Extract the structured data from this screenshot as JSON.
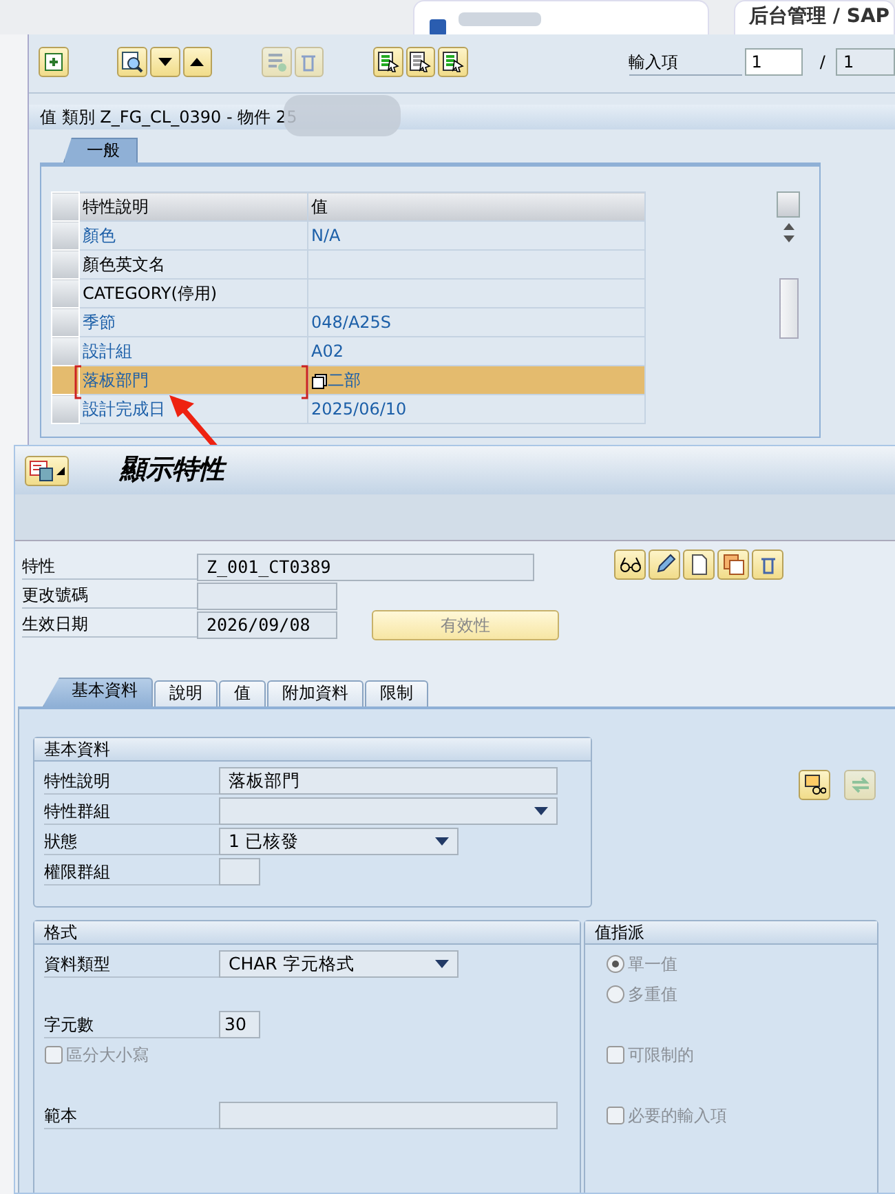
{
  "browser": {
    "tabs": [
      {
        "kind": "blurred"
      },
      {
        "label": "后台管理 / SAP",
        "kind": "text"
      }
    ]
  },
  "upper_window": {
    "toolbar": {
      "entry_label": "輸入項",
      "entry_value": "1",
      "separator": "/",
      "entry_total": "1"
    },
    "section_title": "值 類別 Z_FG_CL_0390 - 物件 25",
    "tabs": [
      {
        "label": "一般",
        "selected": true
      }
    ],
    "table": {
      "columns": [
        "特性說明",
        "值"
      ],
      "rows": [
        {
          "cells": [
            "顏色",
            "N/A"
          ],
          "valued": true,
          "selected": false
        },
        {
          "cells": [
            "顏色英文名",
            ""
          ],
          "valued": false,
          "selected": false
        },
        {
          "cells": [
            "CATEGORY(停用)",
            ""
          ],
          "valued": false,
          "selected": false
        },
        {
          "cells": [
            "季節",
            "048/A25S"
          ],
          "valued": true,
          "selected": false
        },
        {
          "cells": [
            "設計組",
            "A02"
          ],
          "valued": true,
          "selected": false
        },
        {
          "cells": [
            "落板部門",
            "二部"
          ],
          "valued": true,
          "selected": true
        },
        {
          "cells": [
            "設計完成日",
            "2025/06/10"
          ],
          "valued": true,
          "selected": false
        }
      ]
    }
  },
  "lower_window": {
    "title": "顯示特性",
    "header_fields": [
      {
        "label": "特性",
        "value": "Z_001_CT0389",
        "kind": "wide"
      },
      {
        "label": "更改號碼",
        "kind": "short"
      },
      {
        "label": "生效日期",
        "value": "2026/09/08",
        "kind": "short"
      }
    ],
    "validity_button": {
      "label": "有效性",
      "disabled": true
    },
    "tabs": [
      {
        "label": "基本資料",
        "selected": true
      },
      {
        "label": "說明",
        "selected": false
      },
      {
        "label": "值",
        "selected": false
      },
      {
        "label": "附加資料",
        "selected": false
      },
      {
        "label": "限制",
        "selected": false
      }
    ],
    "basic_group": {
      "title": "基本資料",
      "fields": [
        {
          "label": "特性說明",
          "value": "落板部門",
          "kind": "text"
        },
        {
          "label": "特性群組",
          "kind": "dropdown_wide"
        },
        {
          "label": "狀態",
          "value": "1 已核發",
          "kind": "dropdown"
        },
        {
          "label": "權限群組",
          "kind": "tiny"
        }
      ]
    },
    "format_group": {
      "title": "格式",
      "data_type": {
        "label": "資料類型",
        "value": "CHAR 字元格式"
      },
      "length": {
        "label": "字元數",
        "value": "30"
      },
      "case_sensitive": {
        "label": "區分大小寫",
        "checked": false,
        "disabled": true
      },
      "template": {
        "label": "範本"
      }
    },
    "value_group": {
      "title": "值指派",
      "radios": [
        {
          "label": "單一值",
          "selected": true,
          "disabled": true
        },
        {
          "label": "多重值",
          "selected": false,
          "disabled": true
        }
      ],
      "checkboxes": [
        {
          "label": "可限制的",
          "checked": false,
          "disabled": true
        },
        {
          "label": "必要的輸入項",
          "checked": false,
          "disabled": true
        }
      ]
    }
  }
}
